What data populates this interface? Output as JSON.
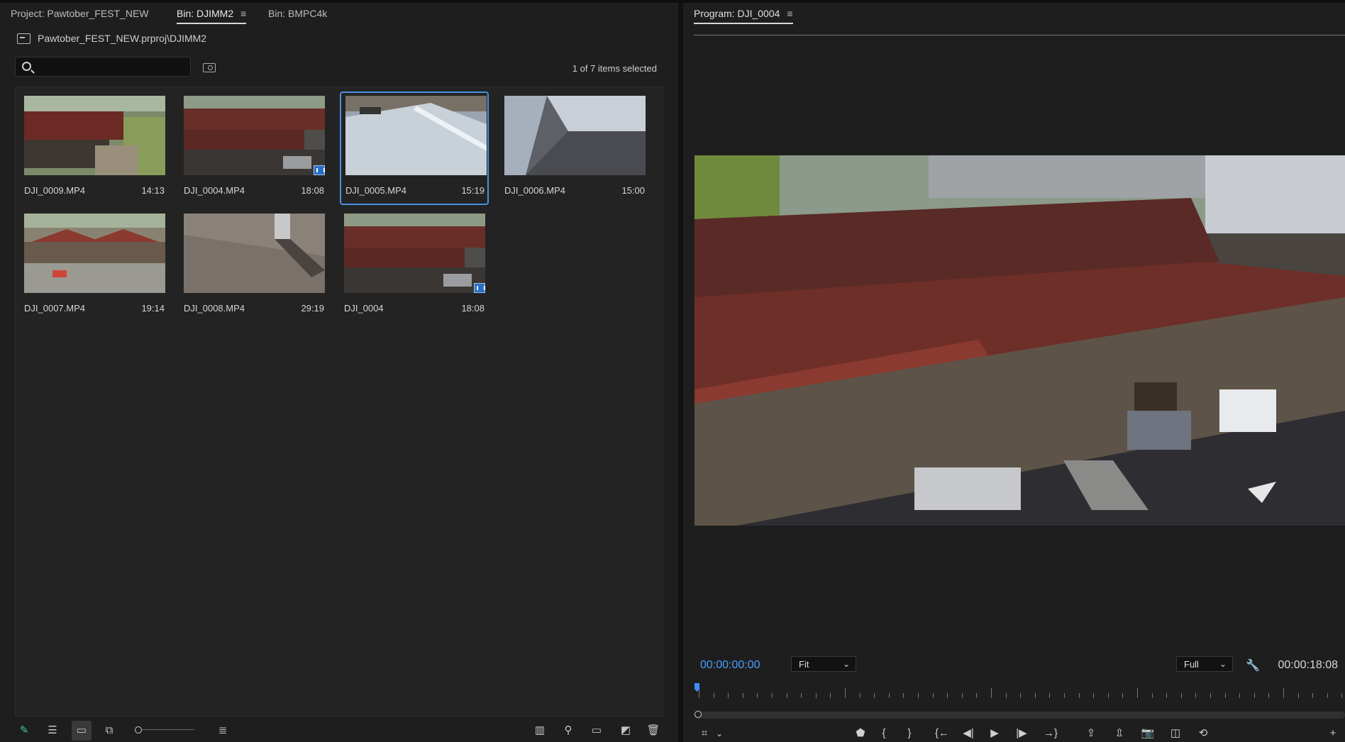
{
  "project_panel": {
    "tabs": [
      {
        "label": "Project: Pawtober_FEST_NEW"
      },
      {
        "label": "Bin: DJIMM2"
      },
      {
        "label": "Bin: BMPC4k"
      }
    ],
    "menu_glyph": "≡",
    "path": "Pawtober_FEST_NEW.prproj\\DJIMM2",
    "search": {
      "placeholder": "",
      "value": ""
    },
    "selection_count": "1 of 7 items selected",
    "items": [
      {
        "name": "DJI_0009.MP4",
        "duration": "14:13"
      },
      {
        "name": "DJI_0004.MP4",
        "duration": "18:08"
      },
      {
        "name": "DJI_0005.MP4",
        "duration": "15:19"
      },
      {
        "name": "DJI_0006.MP4",
        "duration": "15:00"
      },
      {
        "name": "DJI_0007.MP4",
        "duration": "19:14"
      },
      {
        "name": "DJI_0008.MP4",
        "duration": "29:19"
      },
      {
        "name": "DJI_0004",
        "duration": "18:08"
      }
    ],
    "bottom_icons": {
      "write": "✎",
      "list": "☰",
      "icon_view": "▭",
      "freeform": "⧉",
      "sort": "≣",
      "automate": "▥",
      "find": "⚲",
      "new_bin": "▭",
      "new_item": "◩",
      "clear": "🗑"
    }
  },
  "program_monitor": {
    "title": "Program: DJI_0004",
    "menu_glyph": "≡",
    "timecode_current": "00:00:00:00",
    "timecode_duration": "00:00:18:08",
    "zoom": "Fit",
    "resolution": "Full",
    "icons": {
      "wrench": "🔧",
      "marker": "⬟",
      "in": "{",
      "out": "}",
      "go_in": "{←",
      "step_back": "◀|",
      "play": "▶",
      "step_fwd": "|▶",
      "go_out": "→}",
      "lift": "⇪",
      "extract": "⇫",
      "export_frame": "📷",
      "comparison": "◫",
      "vr": "⟲",
      "add": "+",
      "safe_margins": "⌗",
      "dropdown": "⌄"
    }
  }
}
